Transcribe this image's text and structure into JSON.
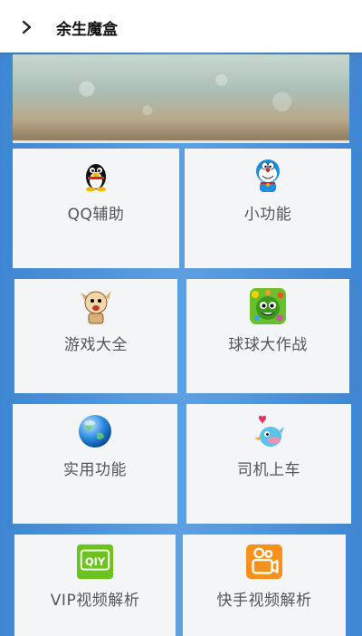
{
  "header": {
    "title": "余生魔盒",
    "back_icon": "chevron-right-icon"
  },
  "banner": {
    "description_icon": "bokeh-sand-banner"
  },
  "tiles": [
    {
      "label": "QQ辅助",
      "icon": "qq-penguin-icon"
    },
    {
      "label": "小功能",
      "icon": "doraemon-icon"
    },
    {
      "label": "游戏大全",
      "icon": "cartoon-character-icon"
    },
    {
      "label": "球球大作战",
      "icon": "ball-battle-game-icon"
    },
    {
      "label": "实用功能",
      "icon": "globe-icon"
    },
    {
      "label": "司机上车",
      "icon": "bird-heart-icon"
    },
    {
      "label": "VIP视频解析",
      "icon": "iqiyi-icon",
      "icon_text": "QIY"
    },
    {
      "label": "快手视频解析",
      "icon": "kuaishou-camera-icon"
    }
  ],
  "colors": {
    "background": "#4a8fd6",
    "tile": "#f4f5f7",
    "label": "#555555"
  }
}
